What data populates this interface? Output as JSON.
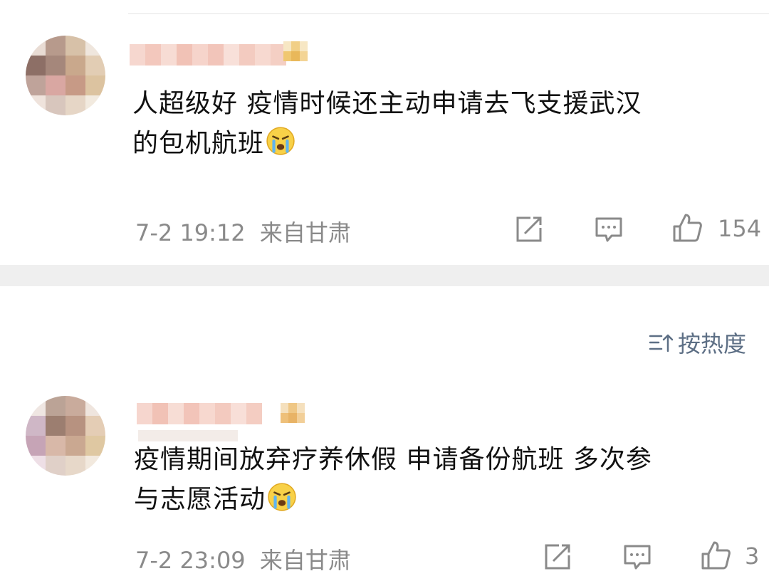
{
  "comments": [
    {
      "text_line1": "人超级好 疫情时候还主动申请去飞支援武汉",
      "text_line2": "的包机航班",
      "time": "7-2 19:12",
      "location": "来自甘肃",
      "like_count": "154"
    },
    {
      "text_line1": "疫情期间放弃疗养休假 申请备份航班 多次参",
      "text_line2": "与志愿活动",
      "time": "7-2 23:09",
      "location": "来自甘肃",
      "like_count": "3"
    }
  ],
  "sort": {
    "label": "按热度"
  },
  "icons": {
    "share": "share-icon",
    "comment": "comment-icon",
    "like": "thumbs-up-icon",
    "emoji": "crying-face-icon",
    "sort": "sort-icon"
  },
  "colors": {
    "text": "#111111",
    "meta": "#8a8a8a",
    "sort_accent": "#5d6f85",
    "separator": "#efefef"
  }
}
